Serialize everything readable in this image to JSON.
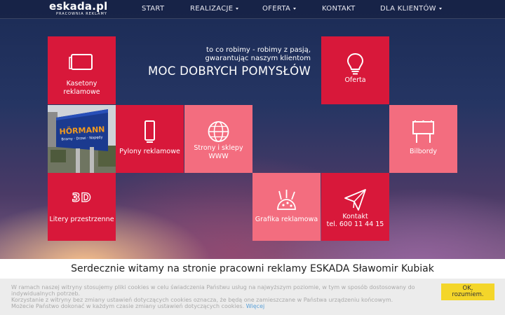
{
  "logo": {
    "main": "eskada.pl",
    "sub": "PRACOWNIA REKLAMY"
  },
  "nav": {
    "start": "START",
    "realizacje": "REALIZACJE",
    "oferta": "OFERTA",
    "kontakt": "KONTAKT",
    "dla_klientow": "DLA KLIENTÓW"
  },
  "hero": {
    "tagline_1": "to co robimy - robimy z pasją,",
    "tagline_2": "gwarantując naszym klientom",
    "headline": "MOC DOBRYCH POMYSŁÓW"
  },
  "tiles": {
    "kasetony": "Kasetony reklamowe",
    "oferta": "Oferta",
    "pylony": "Pylony reklamowe",
    "strony": "Strony i sklepy WWW",
    "bilbordy": "Bilbordy",
    "litery": "Litery przestrzenne",
    "litery_icon": "3D",
    "grafika": "Grafika reklamowa",
    "kontakt": "Kontakt",
    "kontakt_phone": "tel. 600 11 44 15"
  },
  "photo": {
    "brand": "HÖRMANN",
    "slogan": "Bramy · Drzwi · Napędy"
  },
  "welcome": "Serdecznie witamy na stronie pracowni reklamy ESKADA Sławomir Kubiak",
  "cookie": {
    "line1": "W ramach naszej witryny stosujemy pliki cookies w celu świadczenia Państwu usług na najwyższym poziomie, w tym w sposób dostosowany do indywidualnych potrzeb.",
    "line2": "Korzystanie z witryny bez zmiany ustawień dotyczących cookies oznacza, że będą one zamieszczane w Państwa urządzeniu końcowym.",
    "line3": "Możecie Państwo dokonać w każdym czasie zmiany ustawień dotyczących cookies.",
    "more": "Więcej",
    "ok_1": "OK,",
    "ok_2": "rozumiem."
  },
  "colors": {
    "tile_red": "#d8183a",
    "tile_pink": "#f36d7f",
    "ok_button": "#f4d62a",
    "link": "#5aa0d8"
  }
}
